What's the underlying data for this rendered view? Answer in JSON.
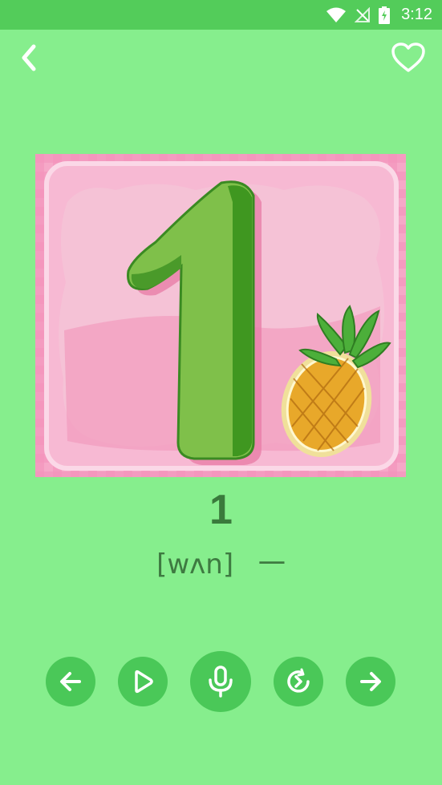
{
  "status_bar": {
    "time": "3:12",
    "icons": [
      "wifi-icon",
      "signal-off-icon",
      "battery-charging-icon"
    ]
  },
  "header": {
    "back_icon": "chevron-left-icon",
    "favorite_icon": "heart-outline-icon"
  },
  "card": {
    "image": "number-one-with-pineapple-illustration"
  },
  "word": {
    "number": "1",
    "phonetic": "[wʌn]",
    "meaning": "一"
  },
  "controls": [
    {
      "name": "previous-button",
      "icon": "arrow-left-icon"
    },
    {
      "name": "play-button",
      "icon": "play-icon"
    },
    {
      "name": "record-button",
      "icon": "microphone-icon"
    },
    {
      "name": "replay-button",
      "icon": "replay-icon"
    },
    {
      "name": "next-button",
      "icon": "arrow-right-icon"
    }
  ],
  "colors": {
    "background": "#86ee8d",
    "status_bar": "#53cc5a",
    "button": "#4ac858",
    "text": "#3a7a3c"
  }
}
